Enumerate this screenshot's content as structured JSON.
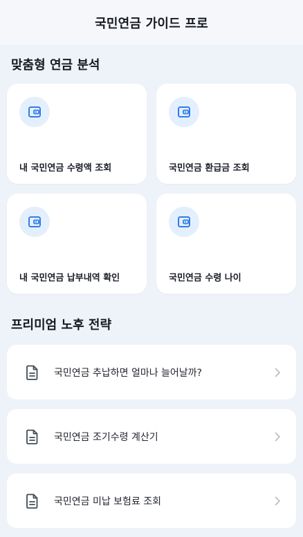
{
  "header": {
    "title": "국민연금 가이드 프로"
  },
  "analysis": {
    "title": "맞춤형 연금 분석",
    "cards": [
      {
        "label": "내 국민연금 수령액 조회",
        "icon": "wallet-icon"
      },
      {
        "label": "국민연금 환급금 조회",
        "icon": "wallet-icon"
      },
      {
        "label": "내 국민연금 납부내역 확인",
        "icon": "wallet-icon"
      },
      {
        "label": "국민연금 수령 나이",
        "icon": "wallet-icon"
      }
    ]
  },
  "premium": {
    "title": "프리미엄 노후 전략",
    "items": [
      {
        "label": "국민연금 추납하면 얼마나 늘어날까?",
        "icon": "document-icon"
      },
      {
        "label": "국민연금 조기수령 계산기",
        "icon": "document-icon"
      },
      {
        "label": "국민연금 미납 보험료 조회",
        "icon": "document-icon"
      }
    ]
  },
  "colors": {
    "accent": "#2f7de8",
    "icon_bg": "#e4effd",
    "background": "#eef3f9"
  }
}
